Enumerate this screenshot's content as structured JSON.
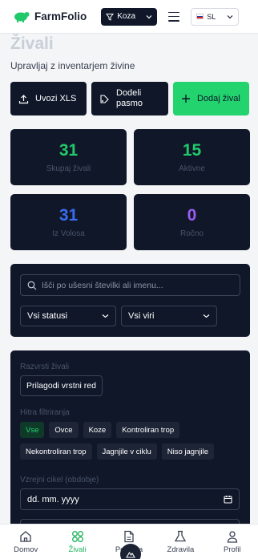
{
  "header": {
    "brand": "FarmFolio",
    "species_filter": "Koza",
    "language": "SL"
  },
  "page": {
    "title": "Živali",
    "subtitle": "Upravljaj z inventarjem živine"
  },
  "actions": {
    "export": "Uvozi XLS",
    "assign_line1": "Dodeli",
    "assign_line2": "pasmo",
    "add": "Dodaj žival"
  },
  "stats": [
    {
      "value": "31",
      "label": "Skupaj živali",
      "color": "#22c96a"
    },
    {
      "value": "15",
      "label": "Aktivne",
      "color": "#22c96a"
    },
    {
      "value": "31",
      "label": "Iz Volosa",
      "color": "#3b6cf0"
    },
    {
      "value": "0",
      "label": "Ročno",
      "color": "#9b5cf0"
    }
  ],
  "filters": {
    "search_placeholder": "Išči po ušesni številki ali imenu...",
    "status": "Vsi statusi",
    "source": "Vsi viri"
  },
  "sorting": {
    "heading": "Razvrsti živali",
    "custom_order": "Prilagodi vrstni red",
    "quick_heading": "Hitra filtriranja",
    "chips_row1": [
      "Vse",
      "Ovce",
      "Koze",
      "Kontroliran trop"
    ],
    "chips_row2": [
      "Nekontroliran trop",
      "Jagnjile v ciklu",
      "Niso jagnjile"
    ],
    "cycle_heading": "Vzrejni cikel (obdobje)",
    "date_placeholder": "dd. mm. yyyy"
  },
  "nav": {
    "items": [
      "Domov",
      "Živali",
      "Poročila",
      "Zdravila",
      "Profil"
    ],
    "active": "Živali"
  },
  "colors": {
    "accent": "#22d36e",
    "panel": "#0f1729"
  }
}
